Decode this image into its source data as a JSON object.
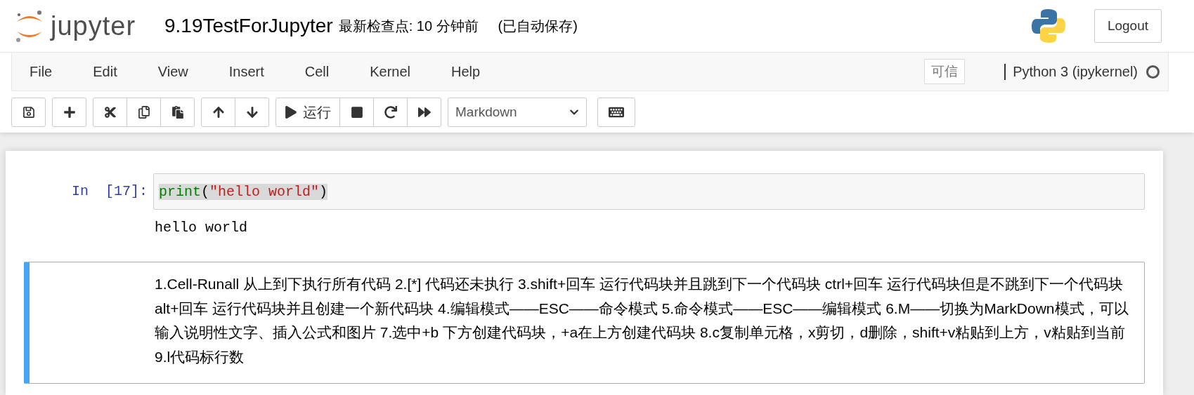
{
  "header": {
    "logo_text": "jupyter",
    "notebook_name": "9.19TestForJupyter",
    "checkpoint": "最新检查点: 10 分钟前",
    "autosave": "(已自动保存)",
    "logout": "Logout"
  },
  "menu": [
    "File",
    "Edit",
    "View",
    "Insert",
    "Cell",
    "Kernel",
    "Help"
  ],
  "trusted": "可信",
  "kernel": {
    "name": "Python 3 (ipykernel)"
  },
  "toolbar": [
    {
      "buttons": [
        {
          "kind": "save"
        }
      ]
    },
    {
      "buttons": [
        {
          "kind": "add"
        }
      ]
    },
    {
      "buttons": [
        {
          "kind": "cut"
        },
        {
          "kind": "copy"
        },
        {
          "kind": "paste"
        }
      ]
    },
    {
      "buttons": [
        {
          "kind": "up"
        },
        {
          "kind": "down"
        }
      ]
    },
    {
      "buttons": [
        {
          "kind": "run",
          "label": "运行"
        },
        {
          "kind": "stop"
        },
        {
          "kind": "restart"
        },
        {
          "kind": "run-all"
        }
      ]
    }
  ],
  "cell_type": "Markdown",
  "cells": [
    {
      "kind": "code",
      "prompt": "In  [17]:",
      "tokens": [
        {
          "kind": "builtin",
          "text": "print"
        },
        {
          "kind": "paren",
          "text": "("
        },
        {
          "kind": "string",
          "text": "\"hello world\""
        },
        {
          "kind": "paren",
          "text": ")"
        }
      ],
      "output": "hello world",
      "selected": false
    },
    {
      "kind": "markdown",
      "text": "1.Cell-Runall 从上到下执行所有代码 2.[*] 代码还未执行 3.shift+回车 运行代码块并且跳到下一个代码块 ctrl+回车 运行代码块但是不跳到下一个代码块 alt+回车 运行代码块并且创建一个新代码块 4.编辑模式——ESC——命令模式 5.命令模式——ESC——编辑模式 6.M——切换为MarkDown模式，可以输入说明性文字、插入公式和图片 7.选中+b 下方创建代码块，+a在上方创建代码块 8.c复制单元格，x剪切，d删除，shift+v粘贴到上方，v粘贴到当前 9.l代码标行数",
      "selected": true
    }
  ]
}
